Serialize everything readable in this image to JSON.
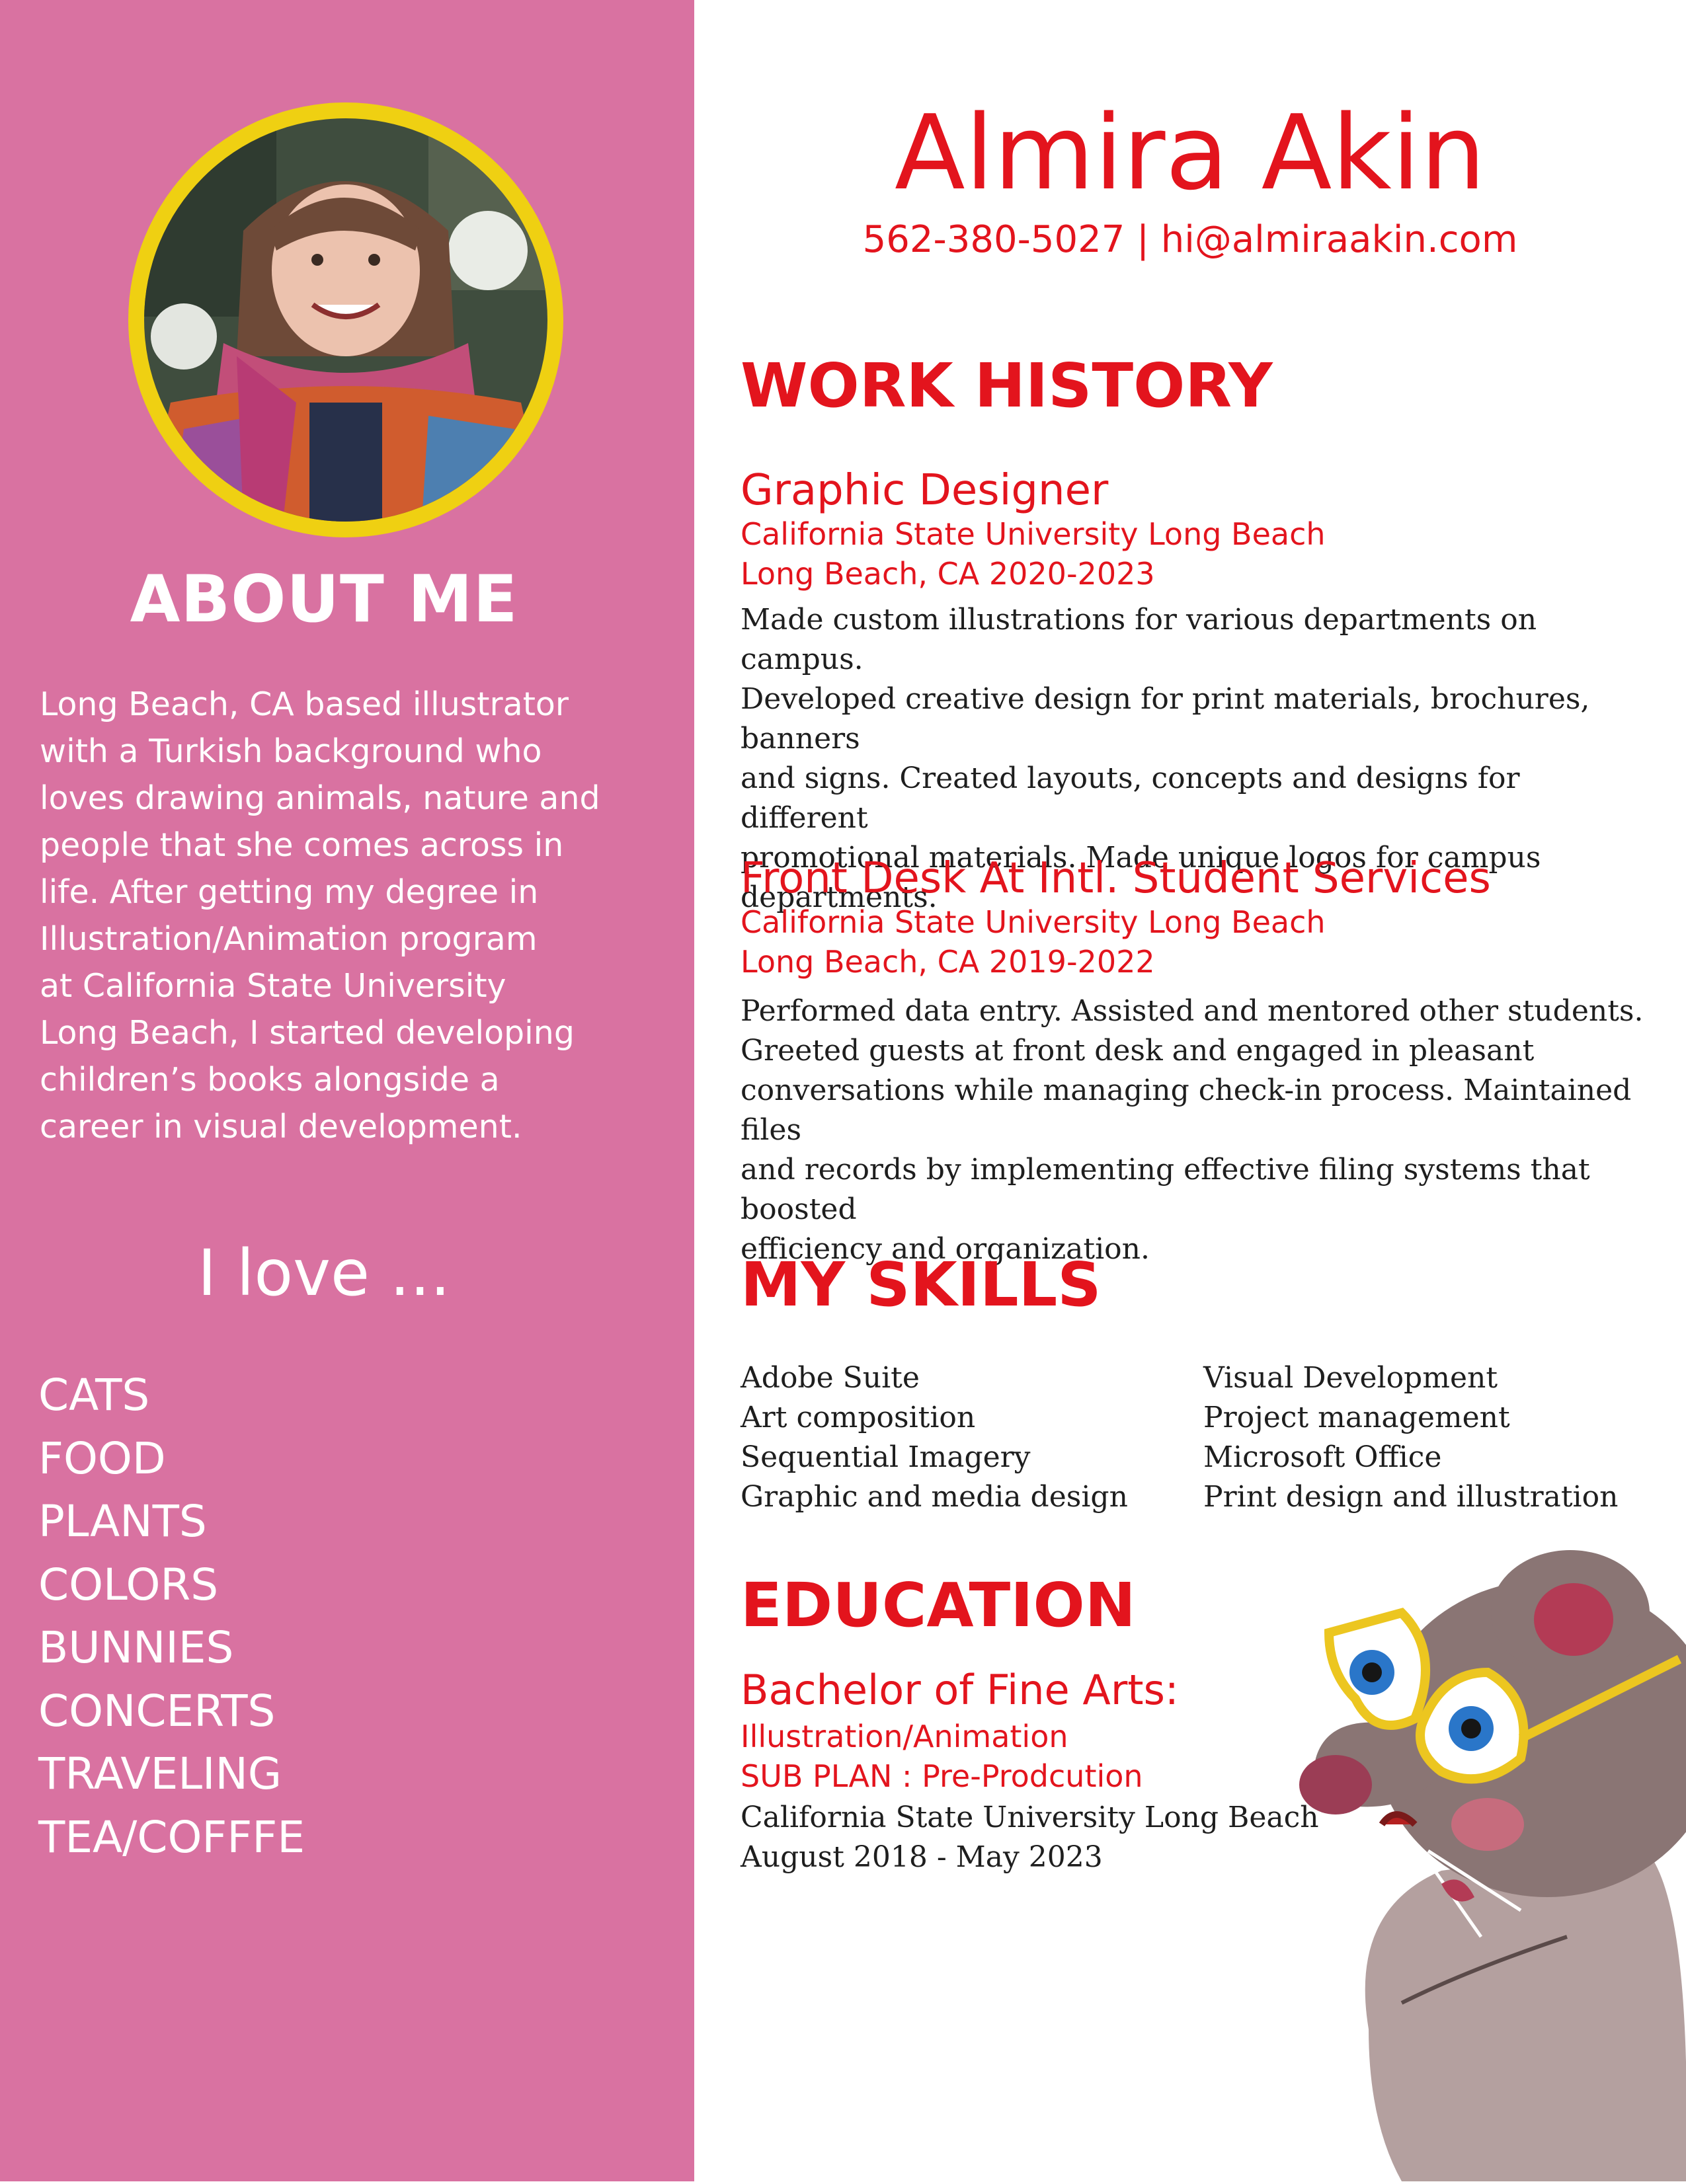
{
  "colors": {
    "sidebar_bg": "#d972a1",
    "accent_red": "#e3141d",
    "photo_ring": "#efd012",
    "body_text": "#1e1e1e"
  },
  "sidebar": {
    "about_title": "ABOUT ME",
    "about_text": "Long Beach, CA based illustrator\nwith a Turkish background who\nloves drawing animals, nature and\npeople that she comes across in\nlife.  After getting my degree in\nIllustration/Animation program\nat California State University\nLong Beach, I started developing\nchildren’s books alongside a\ncareer in visual development.",
    "love_title": "I love ...",
    "love_items": [
      "CATS",
      "FOOD",
      "PLANTS",
      "COLORS",
      "BUNNIES",
      "CONCERTS",
      "TRAVELING",
      "TEA/COFFFE"
    ]
  },
  "header": {
    "name": "Almira Akin",
    "contact": "562-380-5027 | hi@almiraakin.com"
  },
  "work_history": {
    "title": "WORK HISTORY",
    "jobs": [
      {
        "title": "Graphic Designer",
        "org": "California State University Long Beach",
        "location_dates": "Long Beach, CA 2020-2023",
        "description": "Made custom illustrations for various departments on campus.\nDeveloped creative design for print materials, brochures, banners\nand signs. Created layouts, concepts and designs for different\npromotional materials. Made unique logos for campus\ndepartments."
      },
      {
        "title": "Front Desk At Intl. Student Services",
        "org": "California State University Long Beach",
        "location_dates": "Long Beach, CA 2019-2022",
        "description": "Performed data entry. Assisted and mentored other students.\nGreeted guests at front desk and engaged in pleasant\nconversations while managing check-in process. Maintained files\nand records by implementing effective filing systems that boosted\nefficiency and organization."
      }
    ]
  },
  "skills": {
    "title": "MY SKILLS",
    "left": [
      "Adobe Suite",
      "Art composition",
      "Sequential Imagery",
      "Graphic and media design"
    ],
    "right": [
      "Visual Development",
      "Project management",
      "Microsoft Office",
      "Print design and illustration"
    ]
  },
  "education": {
    "title": "EDUCATION",
    "degree": "Bachelor of Fine Arts:",
    "major": "Illustration/Animation",
    "sub_plan": "SUB PLAN : Pre-Prodcution",
    "school": "California State University Long Beach",
    "dates": "August 2018 - May 2023"
  }
}
